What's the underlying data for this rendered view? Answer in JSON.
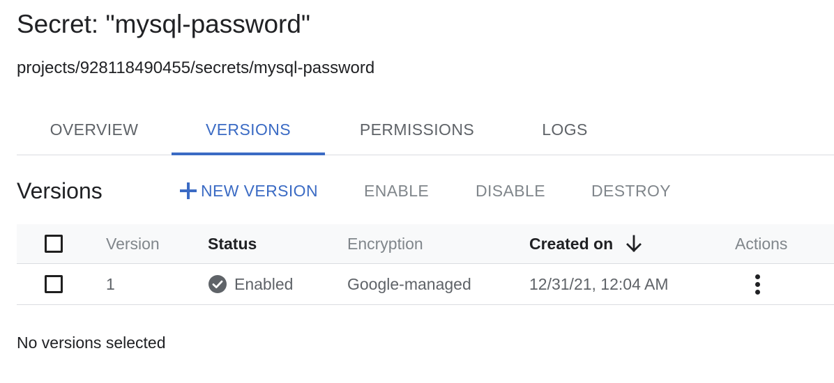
{
  "header": {
    "title": "Secret: \"mysql-password\"",
    "resource_path": "projects/928118490455/secrets/mysql-password"
  },
  "tabs": [
    {
      "label": "OVERVIEW",
      "active": false
    },
    {
      "label": "VERSIONS",
      "active": true
    },
    {
      "label": "PERMISSIONS",
      "active": false
    },
    {
      "label": "LOGS",
      "active": false
    }
  ],
  "versions_section": {
    "title": "Versions",
    "toolbar": {
      "new_version_label": "NEW VERSION",
      "enable_label": "ENABLE",
      "disable_label": "DISABLE",
      "destroy_label": "DESTROY"
    }
  },
  "table": {
    "columns": {
      "version": "Version",
      "status": "Status",
      "encryption": "Encryption",
      "created_on": "Created on",
      "actions": "Actions"
    },
    "rows": [
      {
        "version": "1",
        "status": "Enabled",
        "encryption": "Google-managed",
        "created_on": "12/31/21, 12:04 AM"
      }
    ]
  },
  "selection_status": "No versions selected",
  "icons": {
    "add": "plus-icon",
    "sort": "arrow-down-icon",
    "status": "check-circle-icon",
    "actions": "more-vert-icon"
  },
  "colors": {
    "accent": "#3b6bc4",
    "muted_text": "#80868b",
    "status_icon": "#5f6368"
  }
}
